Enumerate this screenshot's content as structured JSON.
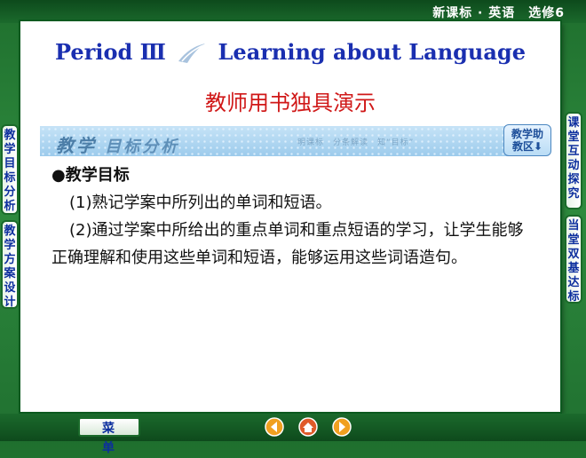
{
  "header": {
    "course": "新课标 · 英语　选修6"
  },
  "title": {
    "part1": "Period Ⅲ",
    "part2": "Learning about Language"
  },
  "subtitle": "教师用书独具演示",
  "section_band": {
    "label_a": "教学",
    "label_b": "目标分析",
    "aux": "明课标　分条解读　知“目标”"
  },
  "helper_button": {
    "line1": "教学助",
    "line2": "教区⬇"
  },
  "content": {
    "heading": "●教学目标",
    "item1": "(1)熟记学案中所列出的单词和短语。",
    "item2": "(2)通过学案中所给出的重点单词和重点短语的学习，让学生能够正确理解和使用这些单词和短语，能够运用这些词语造句。"
  },
  "left_tabs": [
    "教学目标分析",
    "教学方案设计"
  ],
  "right_tabs": [
    "课堂互动探究",
    "当堂双基达标"
  ],
  "bottom": {
    "menu_label": "菜 单"
  },
  "colors": {
    "frame_green": "#2e8b3e",
    "title_blue": "#1a2fb0",
    "subtitle_red": "#d01818",
    "tab_text": "#0c2e9e"
  },
  "icons": [
    "swoosh-icon",
    "prev-arrow-icon",
    "home-icon",
    "next-arrow-icon"
  ]
}
